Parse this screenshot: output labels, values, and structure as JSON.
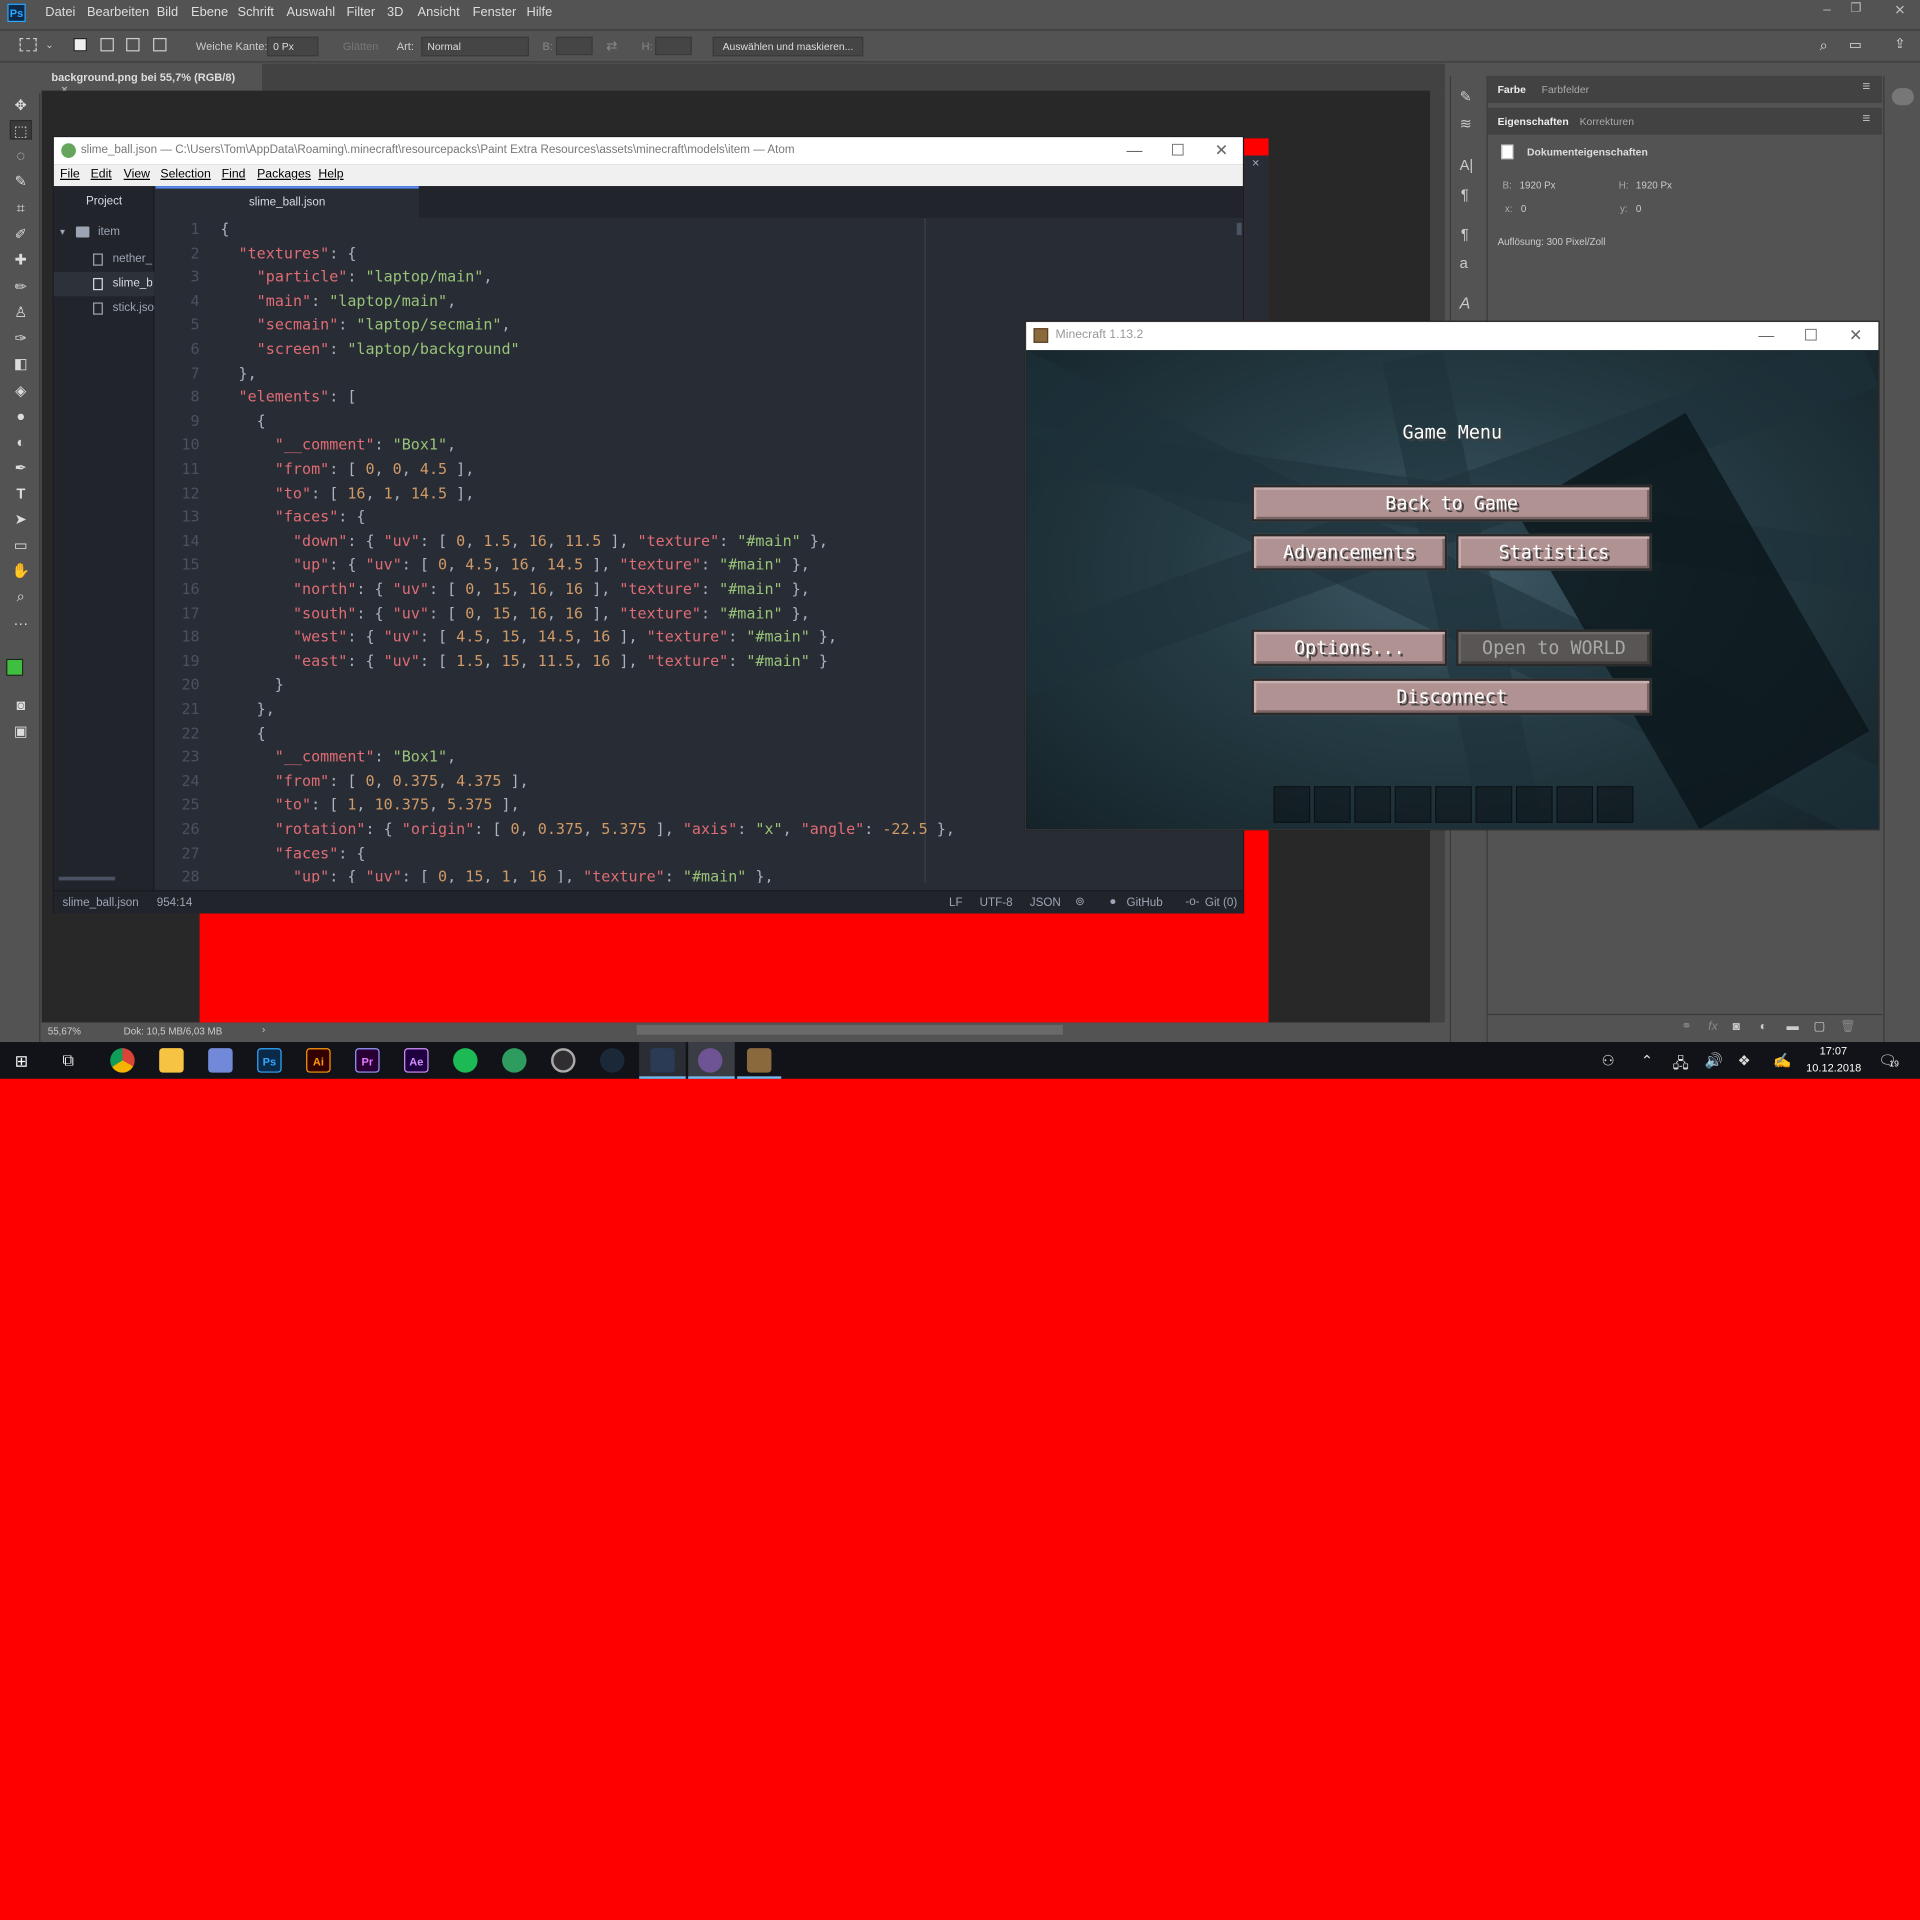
{
  "photoshop": {
    "menu": [
      "Datei",
      "Bearbeiten",
      "Bild",
      "Ebene",
      "Schrift",
      "Auswahl",
      "Filter",
      "3D",
      "Ansicht",
      "Fenster",
      "Hilfe"
    ],
    "options": {
      "feather_label": "Weiche Kante:",
      "feather_value": "0 Px",
      "antialias_label": "Glätten",
      "style_label": "Art:",
      "style_value": "Normal",
      "width_label": "B:",
      "height_label": "H:",
      "select_mask_button": "Auswählen und maskieren..."
    },
    "doc_tab": "background.png bei 55,7% (RGB/8)",
    "doc_tab_close": "×",
    "status": {
      "zoom": "55,67%",
      "doc": "Dok: 10,5 MB/6,03 MB"
    },
    "panels": {
      "tab1": "Farbe",
      "tab2": "Farbfelder",
      "tab3": "Eigenschaften",
      "tab4": "Korrekturen",
      "doc_props": "Dokumenteigenschaften",
      "w_label": "B:",
      "w_value": "1920 Px",
      "h_label": "H:",
      "h_value": "1920 Px",
      "x_label": "x:",
      "x_value": "0",
      "y_label": "y:",
      "y_value": "0",
      "resolution": "Auflösung: 300 Pixel/Zoll"
    }
  },
  "atom": {
    "title": "slime_ball.json — C:\\Users\\Tom\\AppData\\Roaming\\.minecraft\\resourcepacks\\Paint Extra Resources\\assets\\minecraft\\models\\item — Atom",
    "menu": [
      "File",
      "Edit",
      "View",
      "Selection",
      "Find",
      "Packages",
      "Help"
    ],
    "tree_header": "Project",
    "tree": {
      "folder": "item",
      "files": [
        "nether_",
        "slime_b",
        "stick.jso"
      ]
    },
    "tab": "slime_ball.json",
    "status": {
      "file": "slime_ball.json",
      "cursor": "954:14",
      "eol": "LF",
      "encoding": "UTF-8",
      "grammar": "JSON",
      "github": "GitHub",
      "git": "Git (0)"
    }
  },
  "minecraft": {
    "title": "Minecraft 1.13.2",
    "menu_title": "Game Menu",
    "buttons": {
      "back": "Back to Game",
      "advancements": "Advancements",
      "statistics": "Statistics",
      "options": "Options...",
      "open_lan": "Open to WORLD",
      "disconnect": "Disconnect"
    }
  },
  "taskbar": {
    "time": "17:07",
    "date": "10.12.2018",
    "notifications": "19",
    "apps": [
      "chrome-icon",
      "explorer-icon",
      "discord-icon",
      "photoshop-icon",
      "illustrator-icon",
      "premiere-icon",
      "after-effects-icon",
      "spotify-icon",
      "gitkraken-icon",
      "obs-icon",
      "steam-icon",
      "atom-icon",
      "github-desktop-icon",
      "minecraft-icon"
    ],
    "app_labels": {
      "ps": "Ps",
      "ai": "Ai",
      "pr": "Pr",
      "ae": "Ae"
    }
  }
}
